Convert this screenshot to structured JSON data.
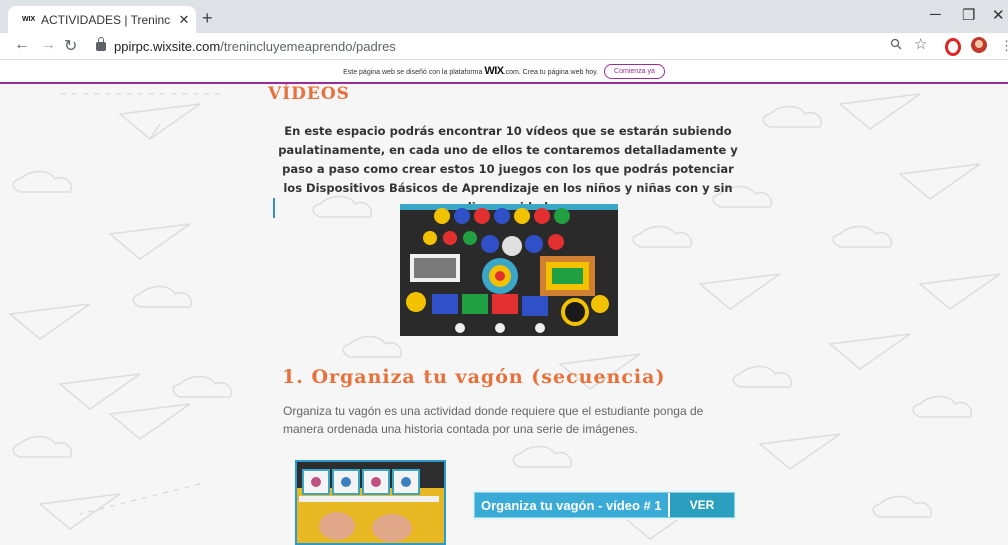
{
  "browser": {
    "tab_favicon": "WIX",
    "tab_title": "ACTIVIDADES | Trenincluyemeap",
    "tab_close": "✕",
    "new_tab": "+",
    "url_host": "ppirpc.wixsite.com",
    "url_path": "/trenincluyemeaprendo/padres",
    "controls": {
      "minimize": "─",
      "restore": "❐",
      "close": "✕"
    }
  },
  "wix_banner": {
    "text_before": "Este página web se diseñó con la plataforma",
    "brand": "WIX",
    "text_after": ".com. Crea tu página web hoy.",
    "button": "Comienza ya"
  },
  "content": {
    "section_title": "VÍDEOS",
    "intro": "En este espacio podrás encontrar 10 vídeos que se estarán subiendo paulatinamente, en cada uno de ellos te contaremos detalladamente y paso a paso como crear estos 10 juegos con los que podrás potenciar los Dispositivos Básicos de Aprendizaje en los niños y niñas con y sin discapacidad.",
    "activity_title": "1. Organiza tu vagón (secuencia)",
    "activity_desc": "Organiza tu vagón es una actividad donde requiere que el estudiante ponga de manera ordenada una historia contada por una serie de imágenes.",
    "video_label": "Organiza tu vagón - vídeo # 1",
    "ver_button": "VER"
  },
  "colors": {
    "accent_orange": "#e8703a",
    "wix_purple": "#9b2c9b",
    "button_blue": "#2b9fbf"
  }
}
